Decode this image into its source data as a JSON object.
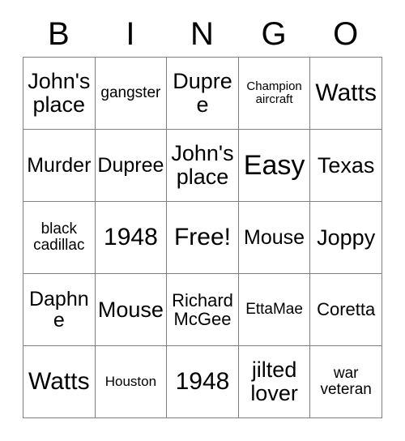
{
  "card": {
    "title": "BINGO",
    "header_letters": [
      "B",
      "I",
      "N",
      "G",
      "O"
    ],
    "free_space_label": "Free!",
    "colors": {
      "border": "#808080",
      "text": "#000000",
      "background": "#ffffff"
    },
    "grid": {
      "columns": 5,
      "rows": 5,
      "cells": [
        [
          {
            "text": "John's place",
            "size": "fs-2xl"
          },
          {
            "text": "gangster",
            "size": "fs-md"
          },
          {
            "text": "Dupree",
            "size": "fs-2xl"
          },
          {
            "text": "Champion aircraft",
            "size": "fs-xs"
          },
          {
            "text": "Watts",
            "size": "fs-3xl"
          }
        ],
        [
          {
            "text": "Murder",
            "size": "fs-xl"
          },
          {
            "text": "Dupree",
            "size": "fs-xl"
          },
          {
            "text": "John's place",
            "size": "fs-2xl"
          },
          {
            "text": "Easy",
            "size": "fs-4xl"
          },
          {
            "text": "Texas",
            "size": "fs-2xl"
          }
        ],
        [
          {
            "text": "black cadillac",
            "size": "fs-md"
          },
          {
            "text": "1948",
            "size": "fs-3xl"
          },
          {
            "text": "Free!",
            "size": "fs-3xl"
          },
          {
            "text": "Mouse",
            "size": "fs-xl"
          },
          {
            "text": "Joppy",
            "size": "fs-2xl"
          }
        ],
        [
          {
            "text": "Daphne",
            "size": "fs-xl"
          },
          {
            "text": "Mouse",
            "size": "fs-2xl"
          },
          {
            "text": "Richard McGee",
            "size": "fs-lg"
          },
          {
            "text": "EttaMae",
            "size": "fs-md"
          },
          {
            "text": "Coretta",
            "size": "fs-lg"
          }
        ],
        [
          {
            "text": "Watts",
            "size": "fs-3xl"
          },
          {
            "text": "Houston",
            "size": "fs-sm"
          },
          {
            "text": "1948",
            "size": "fs-3xl"
          },
          {
            "text": "jilted lover",
            "size": "fs-2xl"
          },
          {
            "text": "war veteran",
            "size": "fs-md"
          }
        ]
      ]
    }
  }
}
